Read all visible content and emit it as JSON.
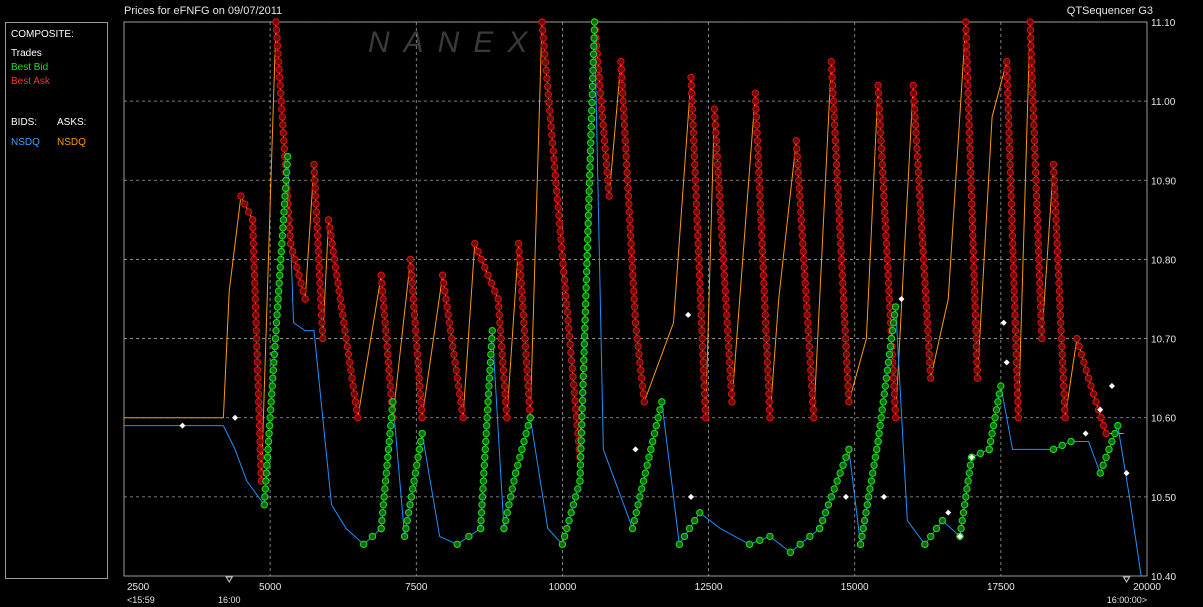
{
  "header": {
    "title": "Prices for  eFNFG  on  09/07/2011",
    "app": "QTSequencer G3"
  },
  "legend": {
    "composite_label": "COMPOSITE:",
    "trades_label": "Trades",
    "best_bid_label": "Best Bid",
    "best_ask_label": "Best Ask",
    "bids_label": "BIDS:",
    "asks_label": "ASKS:",
    "bids_exchange": "NSDQ",
    "asks_exchange": "NSDQ"
  },
  "watermark": "NANEX",
  "colors": {
    "background": "#000000",
    "grid": "#a0a0a0",
    "trades": "#ffffff",
    "best_bid": "#22dd22",
    "best_ask": "#dd1111",
    "bids": "#1e90ff",
    "asks": "#ff9900"
  },
  "chart_data": {
    "type": "line",
    "title": "Prices for  eFNFG  on  09/07/2011",
    "x_ticks": [
      2500,
      5000,
      7500,
      10000,
      12500,
      15000,
      17500,
      20000
    ],
    "x_tick_labels": [
      "2500",
      "5000",
      "7500",
      "10000",
      "12500",
      "15000",
      "17500",
      "20000"
    ],
    "x_sub_labels": [
      "<15:59",
      "16:00",
      "16:00:00>"
    ],
    "xlim": [
      2500,
      20000
    ],
    "y_ticks": [
      10.4,
      10.5,
      10.6,
      10.7,
      10.8,
      10.9,
      11.0,
      11.1
    ],
    "y_tick_labels": [
      "10.40",
      "10.50",
      "10.60",
      "10.70",
      "10.80",
      "10.90",
      "11.00",
      "11.10"
    ],
    "ylim": [
      10.4,
      11.1
    ],
    "grid": true,
    "series": [
      {
        "name": "NSDQ",
        "role": "asks",
        "x": [
          2500,
          4200,
          4300,
          4500,
          4700,
          4850,
          5100,
          5350,
          5600,
          5750,
          5900,
          6000,
          6500,
          6900,
          7100,
          7400,
          7600,
          7950,
          8300,
          8500,
          8900,
          9050,
          9250,
          9450,
          9650,
          10300,
          10550,
          10800,
          11000,
          11250,
          11400,
          11900,
          12200,
          12450,
          12600,
          12900,
          13300,
          13550,
          13700,
          14000,
          14300,
          14600,
          14900,
          15200,
          15400,
          15700,
          16000,
          16300,
          16600,
          16900,
          17100,
          17350,
          17600,
          17800,
          18000,
          18200,
          18400,
          18600,
          18800,
          19000,
          19300,
          19600
        ],
        "values": [
          10.6,
          10.6,
          10.76,
          10.88,
          10.85,
          10.52,
          11.1,
          10.82,
          10.75,
          10.92,
          10.7,
          10.85,
          10.6,
          10.78,
          10.6,
          10.8,
          10.6,
          10.78,
          10.6,
          10.82,
          10.75,
          10.6,
          10.82,
          10.6,
          11.1,
          10.55,
          11.1,
          10.88,
          11.05,
          10.72,
          10.62,
          10.72,
          11.03,
          10.6,
          10.99,
          10.62,
          11.01,
          10.6,
          10.75,
          10.95,
          10.6,
          11.05,
          10.62,
          10.7,
          11.02,
          10.6,
          11.02,
          10.65,
          10.75,
          11.1,
          10.65,
          10.98,
          11.05,
          10.6,
          11.1,
          10.7,
          10.92,
          10.6,
          10.7,
          10.65,
          10.58,
          10.58
        ]
      },
      {
        "name": "NSDQ",
        "role": "bids",
        "x": [
          2500,
          4200,
          4400,
          4600,
          4900,
          5300,
          5400,
          5600,
          5750,
          6050,
          6300,
          6600,
          6900,
          7100,
          7300,
          7600,
          7900,
          8200,
          8600,
          8800,
          9000,
          9200,
          9450,
          9750,
          10000,
          10300,
          10550,
          10700,
          11200,
          11700,
          12000,
          12350,
          12700,
          13200,
          13550,
          13900,
          14400,
          14900,
          15100,
          15400,
          15700,
          15900,
          16200,
          16500,
          16800,
          17000,
          17300,
          17500,
          17700,
          18000,
          18400,
          18700,
          19000,
          19200,
          19500,
          19700,
          19900
        ],
        "values": [
          10.59,
          10.59,
          10.56,
          10.52,
          10.49,
          10.93,
          10.72,
          10.71,
          10.71,
          10.49,
          10.46,
          10.44,
          10.46,
          10.62,
          10.45,
          10.58,
          10.45,
          10.44,
          10.46,
          10.71,
          10.46,
          10.53,
          10.6,
          10.46,
          10.44,
          10.52,
          11.1,
          10.56,
          10.46,
          10.62,
          10.44,
          10.48,
          10.46,
          10.44,
          10.45,
          10.43,
          10.46,
          10.56,
          10.44,
          10.57,
          10.74,
          10.47,
          10.44,
          10.47,
          10.45,
          10.55,
          10.56,
          10.64,
          10.56,
          10.56,
          10.56,
          10.57,
          10.57,
          10.53,
          10.59,
          10.5,
          10.4
        ]
      },
      {
        "name": "Trades",
        "role": "trades",
        "x": [
          3500,
          4400,
          12150,
          11250,
          12200,
          14850,
          15500,
          15800,
          16600,
          16800,
          17000,
          17550,
          17600,
          18950,
          19200,
          19400,
          19650
        ],
        "values": [
          10.59,
          10.6,
          10.73,
          10.56,
          10.5,
          10.5,
          10.5,
          10.75,
          10.48,
          10.45,
          10.55,
          10.72,
          10.67,
          10.58,
          10.61,
          10.64,
          10.53
        ]
      }
    ]
  }
}
